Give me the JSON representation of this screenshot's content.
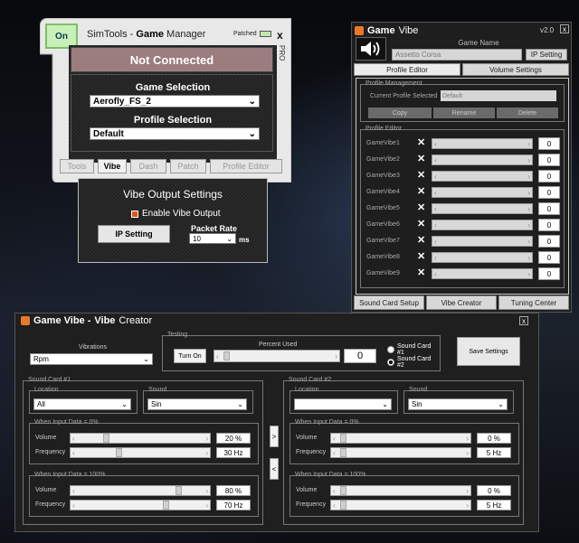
{
  "manager": {
    "on_label": "On",
    "title_prefix": "SimTools - ",
    "title_game": "Game",
    "title_suffix": " Manager",
    "patched_label": "Patched",
    "close": "x",
    "pro": "PRO",
    "status": "Not Connected",
    "game_selection_label": "Game Selection",
    "game_selection_value": "Aerofly_FS_2",
    "profile_selection_label": "Profile Selection",
    "profile_selection_value": "Default",
    "tabs": [
      "Tools",
      "Vibe",
      "Dash",
      "Patch",
      "Profile Editor"
    ]
  },
  "vibe_output": {
    "title": "Vibe Output Settings",
    "enable_label": "Enable Vibe Output",
    "ip_button": "IP Setting",
    "packet_rate_label": "Packet Rate",
    "packet_rate_value": "10",
    "unit": "ms"
  },
  "game_vibe": {
    "title_a": "Game",
    "title_b": " Vibe",
    "version": "v2.0",
    "close": "x",
    "game_name_label": "Game Name",
    "game_name_value": "Assetto Corsa",
    "ip_button": "IP Setting",
    "tabs": [
      "Profile Editor",
      "Volume Settings"
    ],
    "profile_mgmt_label": "Profile Management",
    "current_profile_label": "Current Profile Selected",
    "current_profile_value": "Default",
    "buttons": [
      "Copy",
      "Rename",
      "Delete"
    ],
    "profile_editor_label": "Profile Editor",
    "rows": [
      {
        "name": "GameVibe1",
        "value": "0"
      },
      {
        "name": "GameVibe2",
        "value": "0"
      },
      {
        "name": "GameVibe3",
        "value": "0"
      },
      {
        "name": "GameVibe4",
        "value": "0"
      },
      {
        "name": "GameVibe5",
        "value": "0"
      },
      {
        "name": "GameVibe6",
        "value": "0"
      },
      {
        "name": "GameVibe7",
        "value": "0"
      },
      {
        "name": "GameVibe8",
        "value": "0"
      },
      {
        "name": "GameVibe9",
        "value": "0"
      }
    ],
    "bottom_tabs": [
      "Sound Card Setup",
      "Vibe Creator",
      "Tuning Center"
    ]
  },
  "vibe_creator": {
    "title_a": "Game Vibe - ",
    "title_b": "Vibe",
    "title_c": " Creator",
    "close": "x",
    "vibrations_label": "Vibrations",
    "vibrations_value": "Rpm",
    "testing_label": "Testing",
    "turn_on": "Turn On",
    "percent_used_label": "Percent Used",
    "percent_used_value": "0",
    "sound_card_1": "Sound Card #1",
    "sound_card_2": "Sound Card #2",
    "save_settings": "Save Settings",
    "location_label": "Location",
    "sound_label": "Sound",
    "when_0": "When Input Data = 0%",
    "when_100": "When Input Data = 100%",
    "volume_label": "Volume",
    "frequency_label": "Frequency",
    "left": {
      "location": "All",
      "sound": "Sin",
      "vol0": "20 %",
      "freq0": "30 Hz",
      "vol100": "80 %",
      "freq100": "70 Hz",
      "vol0_level": 0.2,
      "freq0_level": 0.3,
      "vol100_level": 0.8,
      "freq100_level": 0.7
    },
    "right": {
      "location": "",
      "sound": "Sin",
      "vol0": "0 %",
      "freq0": "5 Hz",
      "vol100": "0 %",
      "freq100": "5 Hz",
      "vol0_level": 0,
      "freq0_level": 0,
      "vol100_level": 0,
      "freq100_level": 0
    },
    "copy_right": ">",
    "copy_left": "<"
  }
}
